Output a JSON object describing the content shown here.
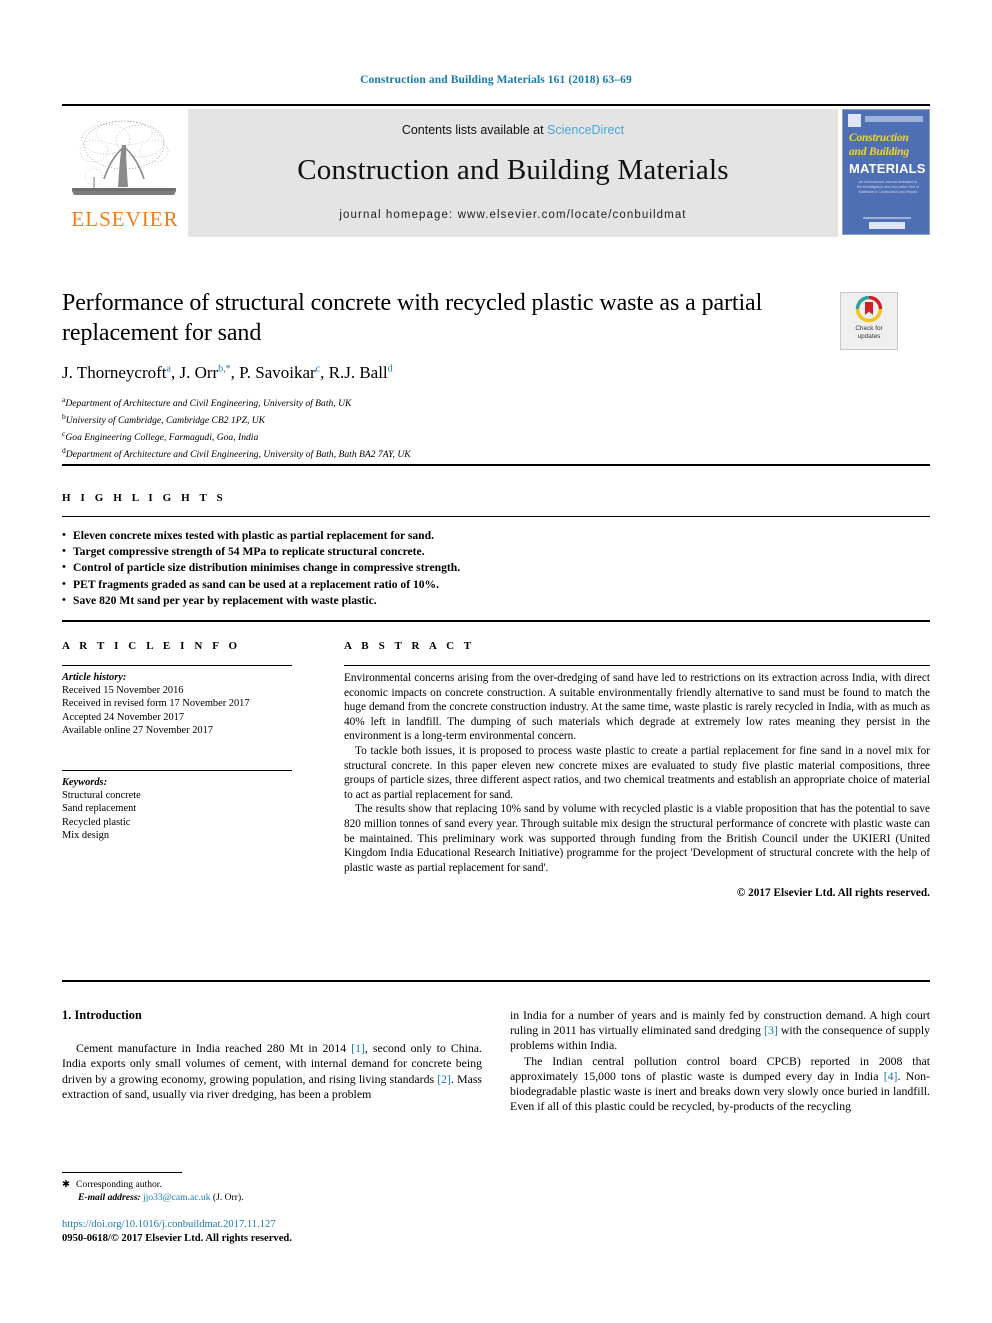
{
  "running_head": "Construction and Building Materials 161 (2018) 63–69",
  "masthead": {
    "contents_prefix": "Contents lists available at ",
    "sciencedirect": "ScienceDirect",
    "journal_title": "Construction and Building Materials",
    "journal_homepage": "journal homepage: www.elsevier.com/locate/conbuildmat",
    "publisher_name": "ELSEVIER",
    "cover": {
      "line1": "Construction",
      "line2": "and Building",
      "line3": "MATERIALS",
      "blurb": "An International Journal dedicated to the Investigation and Innovative Use of Materials in Construction and Repair"
    }
  },
  "article": {
    "title": "Performance of structural concrete with recycled plastic waste as a partial replacement for sand",
    "authors": [
      {
        "name": "J. Thorneycroft",
        "marks": "a"
      },
      {
        "name": "J. Orr",
        "marks": "b,*"
      },
      {
        "name": "P. Savoikar",
        "marks": "c"
      },
      {
        "name": "R.J. Ball",
        "marks": "d"
      }
    ],
    "affiliations": [
      {
        "mark": "a",
        "text": "Department of Architecture and Civil Engineering, University of Bath, UK"
      },
      {
        "mark": "b",
        "text": "University of Cambridge, Cambridge CB2 1PZ, UK"
      },
      {
        "mark": "c",
        "text": "Goa Engineering College, Farmagudi, Goa, India"
      },
      {
        "mark": "d",
        "text": "Department of Architecture and Civil Engineering, University of Bath, Bath BA2 7AY, UK"
      }
    ]
  },
  "crossmark": {
    "line1": "Check for",
    "line2": "updates"
  },
  "highlights": {
    "label": "H I G H L I G H T S",
    "items": [
      "Eleven concrete mixes tested with plastic as partial replacement for sand.",
      "Target compressive strength of 54 MPa to replicate structural concrete.",
      "Control of particle size distribution minimises change in compressive strength.",
      "PET fragments graded as sand can be used at a replacement ratio of 10%.",
      "Save 820 Mt sand per year by replacement with waste plastic."
    ]
  },
  "article_info": {
    "label": "A R T I C L E    I N F O",
    "history_header": "Article history:",
    "history": [
      "Received 15 November 2016",
      "Received in revised form 17 November 2017",
      "Accepted 24 November 2017",
      "Available online 27 November 2017"
    ],
    "keywords_header": "Keywords:",
    "keywords": [
      "Structural concrete",
      "Sand replacement",
      "Recycled plastic",
      "Mix design"
    ]
  },
  "abstract": {
    "label": "A B S T R A C T",
    "paragraphs": [
      "Environmental concerns arising from the over-dredging of sand have led to restrictions on its extraction across India, with direct economic impacts on concrete construction. A suitable environmentally friendly alternative to sand must be found to match the huge demand from the concrete construction industry. At the same time, waste plastic is rarely recycled in India, with as much as 40% left in landfill. The dumping of such materials which degrade at extremely low rates meaning they persist in the environment is a long-term environmental concern.",
      "To tackle both issues, it is proposed to process waste plastic to create a partial replacement for fine sand in a novel mix for structural concrete. In this paper eleven new concrete mixes are evaluated to study five plastic material compositions, three groups of particle sizes, three different aspect ratios, and two chemical treatments and establish an appropriate choice of material to act as partial replacement for sand.",
      "The results show that replacing 10% sand by volume with recycled plastic is a viable proposition that has the potential to save 820 million tonnes of sand every year. Through suitable mix design the structural performance of concrete with plastic waste can be maintained. This preliminary work was supported through funding from the British Council under the UKIERI (United Kingdom India Educational Research Initiative) programme for the project 'Development of structural concrete with the help of plastic waste as partial replacement for sand'."
    ],
    "copyright": "© 2017 Elsevier Ltd. All rights reserved."
  },
  "body": {
    "section_heading": "1. Introduction",
    "left_paragraph_a": "Cement manufacture in India reached 280 Mt in 2014 ",
    "left_ref_1": "[1]",
    "left_paragraph_b": ", second only to China. India exports only small volumes of cement, with internal demand for concrete being driven by a growing economy, growing population, and rising living standards ",
    "left_ref_2": "[2]",
    "left_paragraph_c": ". Mass extraction of sand, usually via river dredging, has been a problem",
    "right_p1_a": "in India for a number of years and is mainly fed by construction demand. A high court ruling in 2011 has virtually eliminated sand dredging ",
    "right_ref_3": "[3]",
    "right_p1_b": " with the consequence of supply problems within India.",
    "right_p2_a": "The Indian central pollution control board CPCB) reported in 2008 that approximately 15,000 tons of plastic waste is dumped every day in India ",
    "right_ref_4": "[4]",
    "right_p2_b": ". Non-biodegradable plastic waste is inert and breaks down very slowly once buried in landfill. Even if all of this plastic could be recycled, by-products of the recycling"
  },
  "footnote": {
    "corresponding": "Corresponding author.",
    "email_label": "E-mail address:",
    "email": "jjo33@cam.ac.uk",
    "email_suffix": "(J. Orr)."
  },
  "footer": {
    "doi": "https://doi.org/10.1016/j.conbuildmat.2017.11.127",
    "issn_line": "0950-0618/© 2017 Elsevier Ltd. All rights reserved."
  },
  "colors": {
    "link_blue": "#1a7ab0",
    "sciencedirect_blue": "#4aa6d6",
    "elsevier_orange": "#f07d18",
    "band_gray": "#e4e4e4",
    "cover_blue": "#4f6fb5",
    "cover_yellow": "#f2d32f"
  }
}
